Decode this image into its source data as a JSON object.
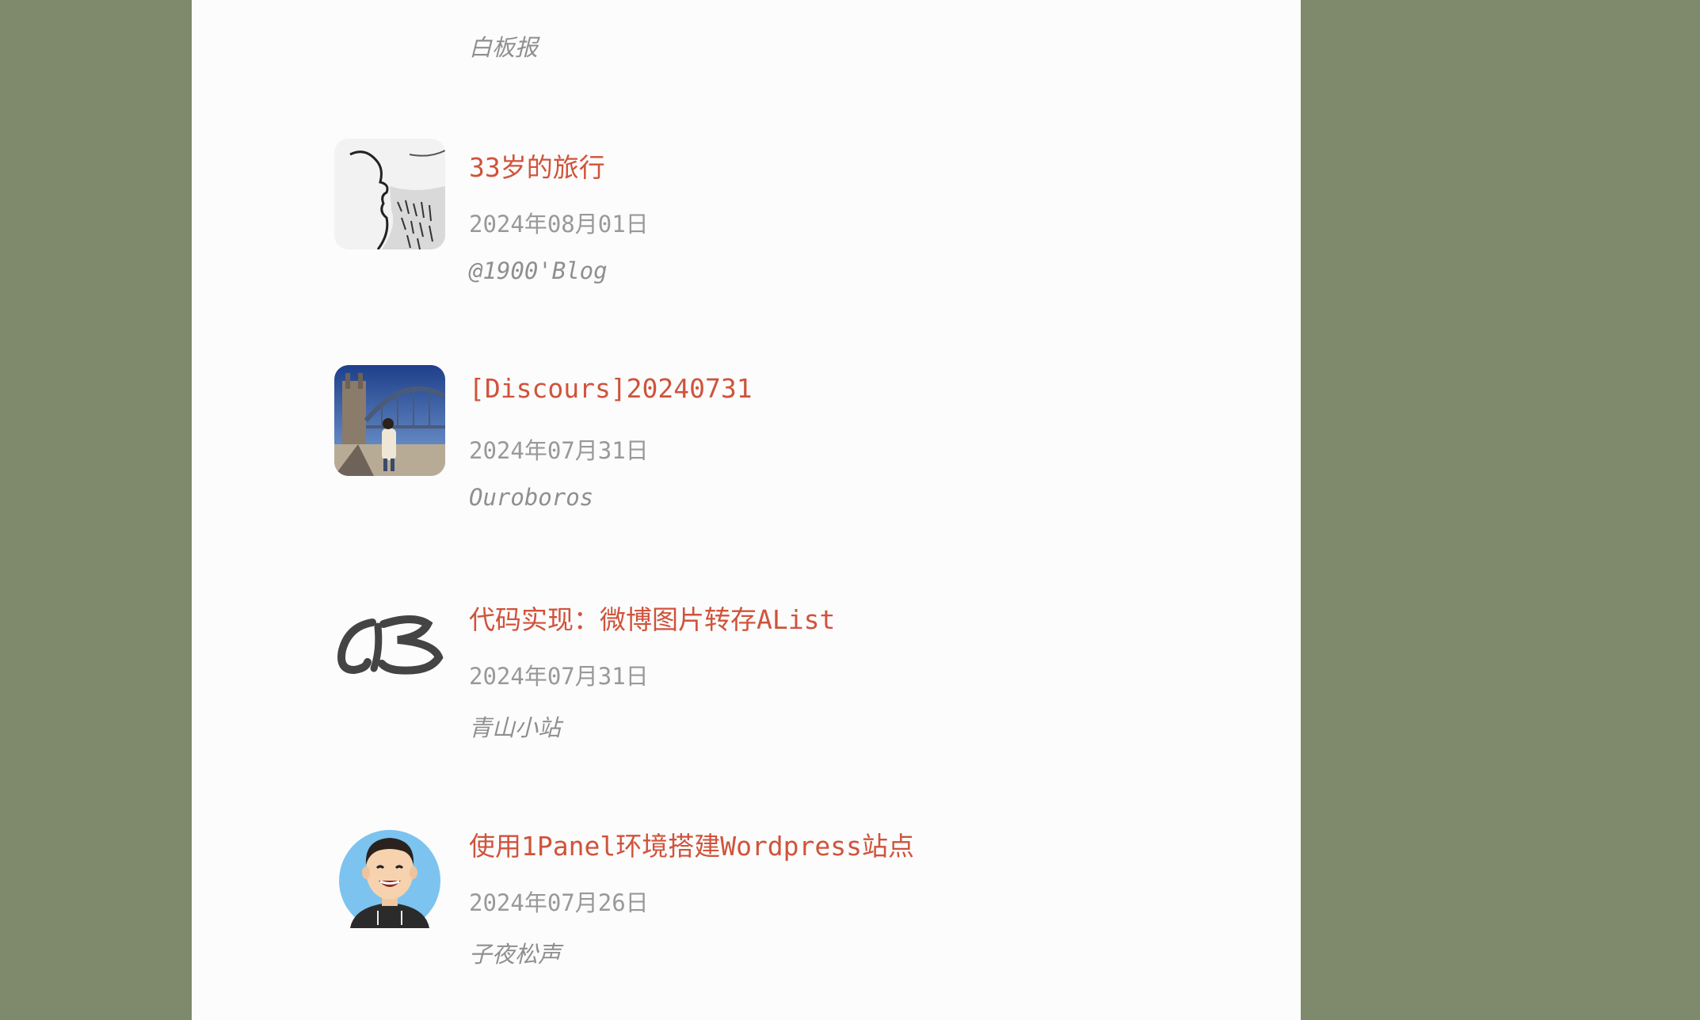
{
  "colors": {
    "background": "#7f896b",
    "panel": "#fcfcfc",
    "title": "#d0533b",
    "meta": "#999999"
  },
  "entries": [
    {
      "title": "",
      "date": "",
      "source": "白板报",
      "avatar_icon": "cartoon-duck-avatar"
    },
    {
      "title": "33岁的旅行",
      "date": "2024年08月01日",
      "source": "@1900'Blog",
      "avatar_icon": "sketch-face-avatar"
    },
    {
      "title": "[Discours]20240731",
      "date": "2024年07月31日",
      "source": "Ouroboros",
      "avatar_icon": "bridge-photo-avatar"
    },
    {
      "title": "代码实现：微博图片转存AList",
      "date": "2024年07月31日",
      "source": "青山小站",
      "avatar_icon": "calligraphy-logo-avatar"
    },
    {
      "title": "使用1Panel环境搭建Wordpress站点",
      "date": "2024年07月26日",
      "source": "子夜松声",
      "avatar_icon": "cartoon-man-avatar"
    }
  ]
}
